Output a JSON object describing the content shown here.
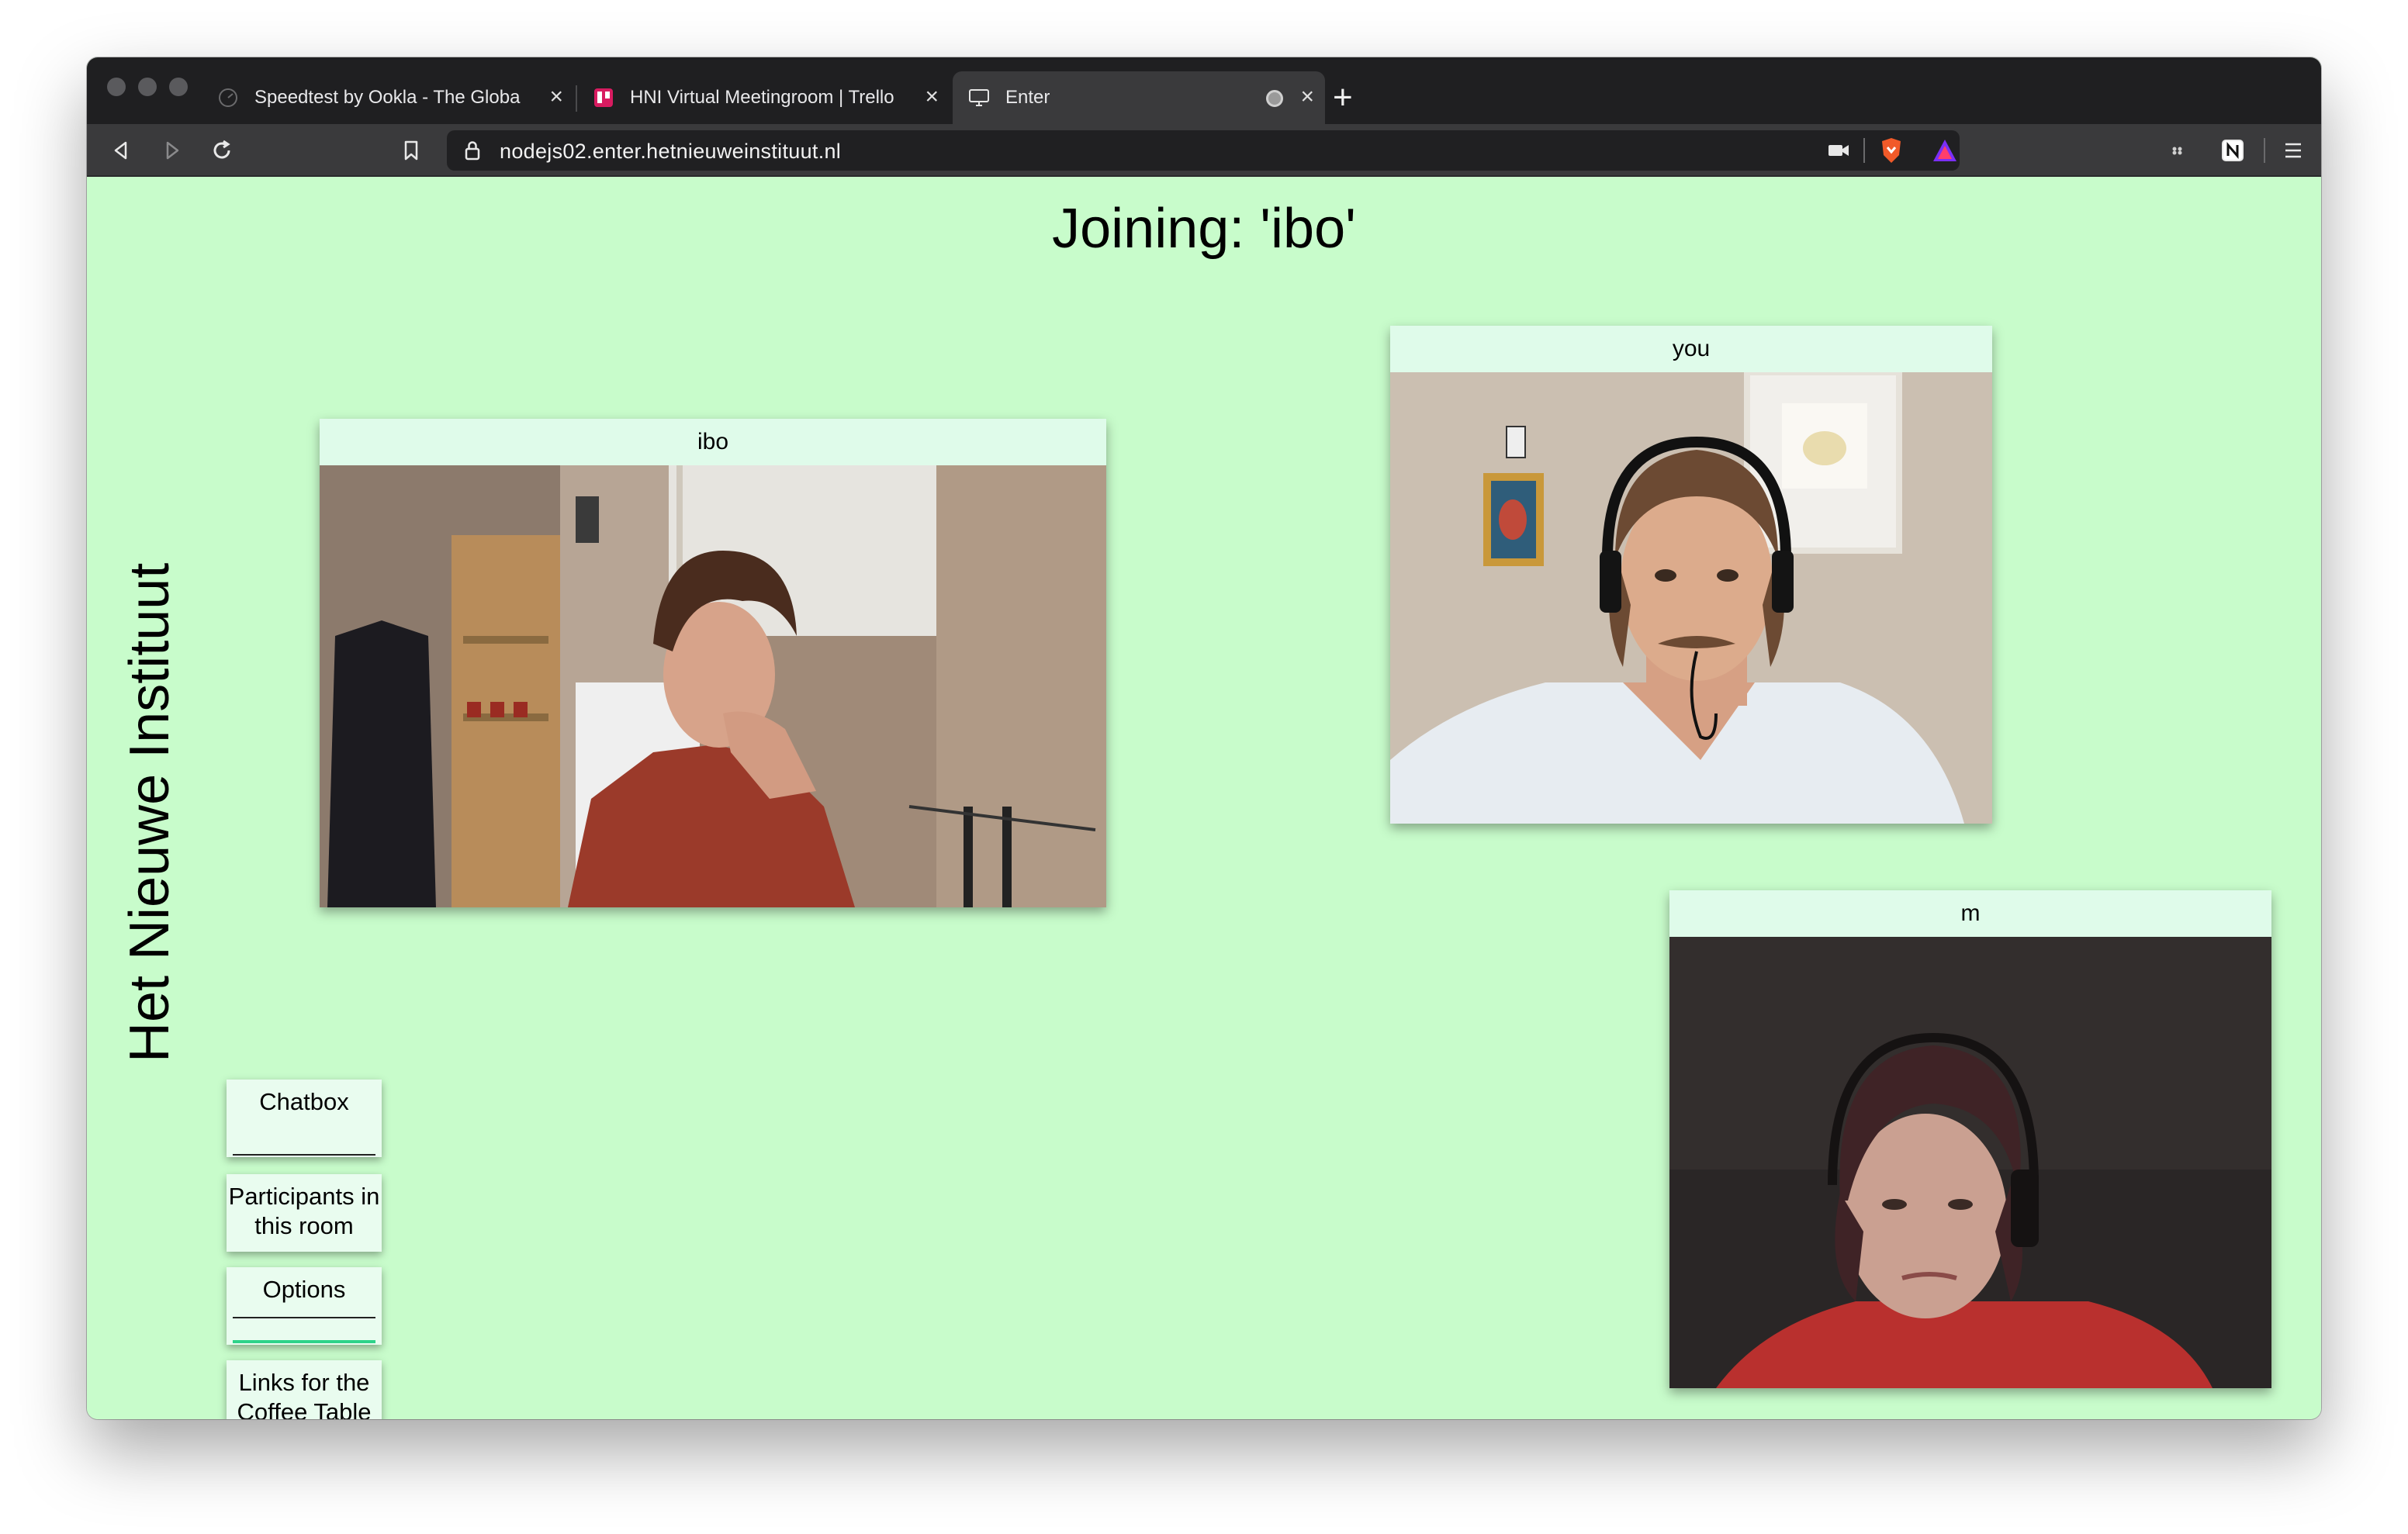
{
  "browser": {
    "tabs": [
      {
        "title": "Speedtest by Ookla - The Globa",
        "icon": "speedtest-icon",
        "active": false
      },
      {
        "title": "HNI Virtual Meetingroom | Trello",
        "icon": "trello-icon",
        "active": false
      },
      {
        "title": "Enter",
        "icon": "monitor-icon",
        "active": true
      }
    ],
    "url": "nodejs02.enter.hetnieuweinstituut.nl"
  },
  "page": {
    "heading": "Joining: 'ibo'",
    "brand": "Het Nieuwe Instituut",
    "participants": [
      {
        "name": "ibo"
      },
      {
        "name": "you"
      },
      {
        "name": "m"
      }
    ],
    "side_buttons": [
      {
        "label": "Chatbox"
      },
      {
        "label": "Participants in this room"
      },
      {
        "label": "Options"
      },
      {
        "label": "Links for the Coffee Table"
      }
    ]
  },
  "colors": {
    "page_background": "#c8fccb",
    "video_label_background": "#dffbea",
    "button_background": "#e9fcef"
  }
}
